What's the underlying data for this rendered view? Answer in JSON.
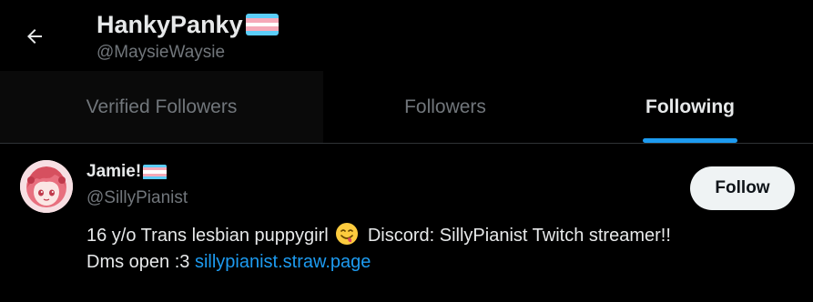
{
  "header": {
    "display_name": "HankyPanky",
    "handle": "@MaysieWaysie",
    "back_icon": "arrow-left-icon",
    "flag_icon": "transgender-flag-icon"
  },
  "tabs": [
    {
      "label": "Verified Followers",
      "active": false
    },
    {
      "label": "Followers",
      "active": false
    },
    {
      "label": "Following",
      "active": true
    }
  ],
  "user": {
    "name": "Jamie!",
    "handle": "@SillyPianist",
    "flag_icon": "transgender-flag-icon",
    "follow_label": "Follow",
    "bio_text": "16 y/o Trans lesbian puppygirl ",
    "bio_emoji": "face-savoring-food-emoji",
    "bio_text_2": " Discord: SillyPianist Twitch streamer!!",
    "bio_line2": "Dms open :3 ",
    "bio_link": "sillypianist.straw.page"
  },
  "colors": {
    "background": "#000000",
    "accent": "#1d9bf0",
    "text_primary": "#e7e9ea",
    "text_secondary": "#71767b",
    "flag_blue": "#5bcefa",
    "flag_pink": "#f5a9b8",
    "flag_white": "#ffffff"
  }
}
